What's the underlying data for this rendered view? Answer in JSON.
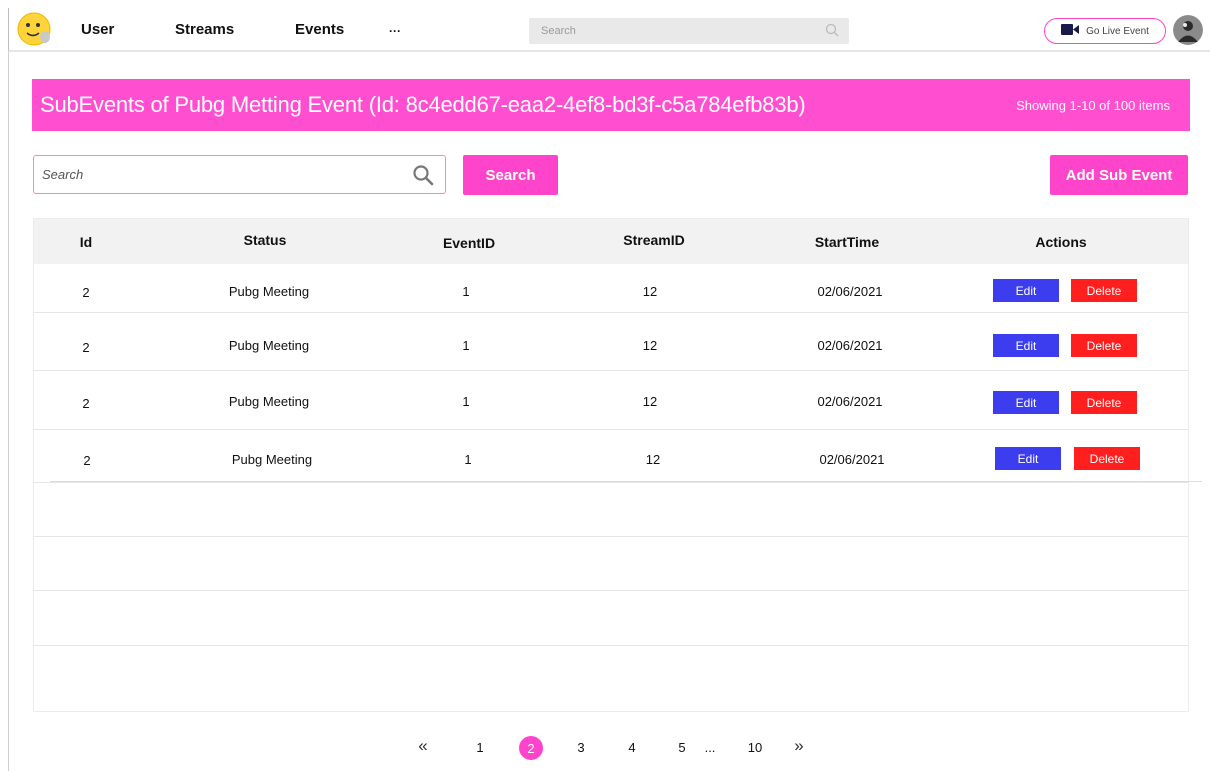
{
  "nav": {
    "items": [
      "User",
      "Streams",
      "Events",
      "···"
    ],
    "search_placeholder": "Search",
    "go_live_label": "Go Live Event"
  },
  "header": {
    "title": "SubEvents of Pubg Metting Event (Id: 8c4edd67-eaa2-4ef8-bd3f-c5a784efb83b)",
    "count": "Showing 1-10 of 100 items"
  },
  "toolbar": {
    "search_placeholder": "Search",
    "search_button": "Search",
    "add_button": "Add Sub Event"
  },
  "table": {
    "columns": [
      "Id",
      "Status",
      "EventID",
      "StreamID",
      "StartTime",
      "Actions"
    ],
    "rows": [
      {
        "id": "2",
        "status": "Pubg Meeting",
        "event_id": "1",
        "stream_id": "12",
        "start_time": "02/06/2021"
      },
      {
        "id": "2",
        "status": "Pubg Meeting",
        "event_id": "1",
        "stream_id": "12",
        "start_time": "02/06/2021"
      },
      {
        "id": "2",
        "status": "Pubg Meeting",
        "event_id": "1",
        "stream_id": "12",
        "start_time": "02/06/2021"
      },
      {
        "id": "2",
        "status": "Pubg Meeting",
        "event_id": "1",
        "stream_id": "12",
        "start_time": "02/06/2021"
      }
    ],
    "edit_label": "Edit",
    "delete_label": "Delete"
  },
  "pagination": {
    "first": "«",
    "last": "»",
    "pages": [
      "1",
      "2",
      "3",
      "4",
      "5"
    ],
    "ellipsis": "...",
    "last_page": "10",
    "current": "2"
  },
  "colors": {
    "accent": "#ff44cc",
    "edit": "#3d3df0",
    "delete": "#ff1f1f"
  }
}
